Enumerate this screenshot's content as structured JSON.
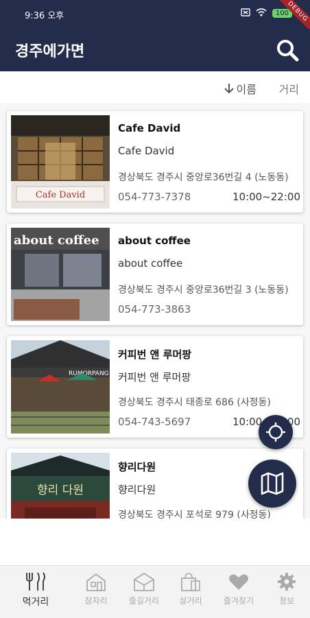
{
  "status_bar": {
    "time": "9:36 오후",
    "battery": "100",
    "debug": "DEBUG"
  },
  "app_bar": {
    "title": "경주에가면",
    "search_icon": "search-icon"
  },
  "sort": {
    "name_label": "이름",
    "name_icon": "arrow-down-icon",
    "distance_label": "거리"
  },
  "places": [
    {
      "title": "Cafe David",
      "subtitle": "Cafe David",
      "address": "경상북도 경주시 중앙로36번길 4 (노동동)",
      "phone": "054-773-7378",
      "hours": "10:00~22:00",
      "sign_text": "Cafe David"
    },
    {
      "title": "about coffee",
      "subtitle": "about coffee",
      "address": "경상북도 경주시 중앙로36번길 3 (노동동)",
      "phone": "054-773-3863",
      "hours": "",
      "sign_text": "about coffee"
    },
    {
      "title": "커피번 앤 루머팡",
      "subtitle": "커피번 앤 루머팡",
      "address": "경상북도 경주시 태종로 686 (사정동)",
      "phone": "054-743-5697",
      "hours": "10:00~22:00",
      "sign_text": "RUMORPANG"
    },
    {
      "title": "향리다원",
      "subtitle": "향리다원",
      "address": "경상북도 경주시 포석로 979 (사정동)",
      "phone": "",
      "hours": "",
      "sign_text": "향리 다원"
    }
  ],
  "fabs": {
    "location_icon": "my-location-icon",
    "map_icon": "map-icon"
  },
  "bottom_nav": [
    {
      "label": "먹거리",
      "icon": "fork-knife-icon",
      "active": true
    },
    {
      "label": "잠자리",
      "icon": "house-icon",
      "active": false
    },
    {
      "label": "즐길거리",
      "icon": "tent-icon",
      "active": false
    },
    {
      "label": "살거리",
      "icon": "shopping-bag-icon",
      "active": false
    },
    {
      "label": "즐겨찾기",
      "icon": "heart-icon",
      "active": false
    },
    {
      "label": "정보",
      "icon": "gear-icon",
      "active": false
    }
  ],
  "colors": {
    "primary": "#232c4a",
    "background": "#ffffff",
    "nav_background": "#f3f3f3"
  }
}
